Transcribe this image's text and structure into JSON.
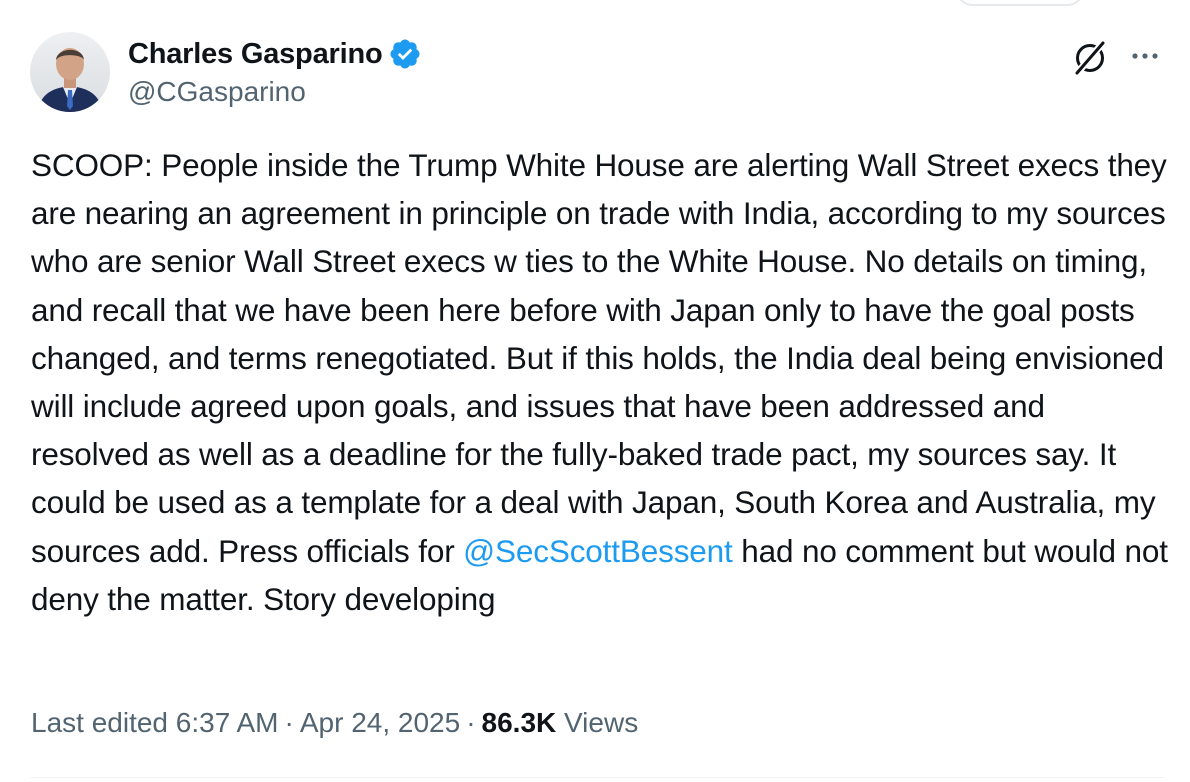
{
  "author": {
    "display_name": "Charles Gasparino",
    "handle": "@CGasparino",
    "verified": true,
    "verified_color": "#1d9bf0"
  },
  "tweet": {
    "text_before_mention": "SCOOP: People inside the Trump White House are alerting Wall Street execs they are nearing an agreement in principle on trade with India, according to my sources who are senior Wall Street execs w ties to the White House. No details on timing, and recall that we have been here before with Japan only to have the goal posts changed, and terms renegotiated. But if this holds, the India deal being envisioned will include agreed upon goals, and issues that have been addressed and resolved as well as a deadline for the fully-baked trade pact, my sources say. It could be used as a template for a deal with Japan, South Korea and Australia, my sources add. Press officials for",
    "mention": "@SecScottBessent",
    "text_after_mention": "had no comment but would not deny the matter. Story developing",
    "mention_color": "#1d9bf0"
  },
  "meta": {
    "edited_label": "Last edited 6:37 AM",
    "separator": "·",
    "date": "Apr 24, 2025",
    "views_count": "86.3K",
    "views_label": "Views"
  },
  "icons": {
    "grok": "grok-icon",
    "more": "more-icon",
    "verified": "verified-badge-icon"
  }
}
